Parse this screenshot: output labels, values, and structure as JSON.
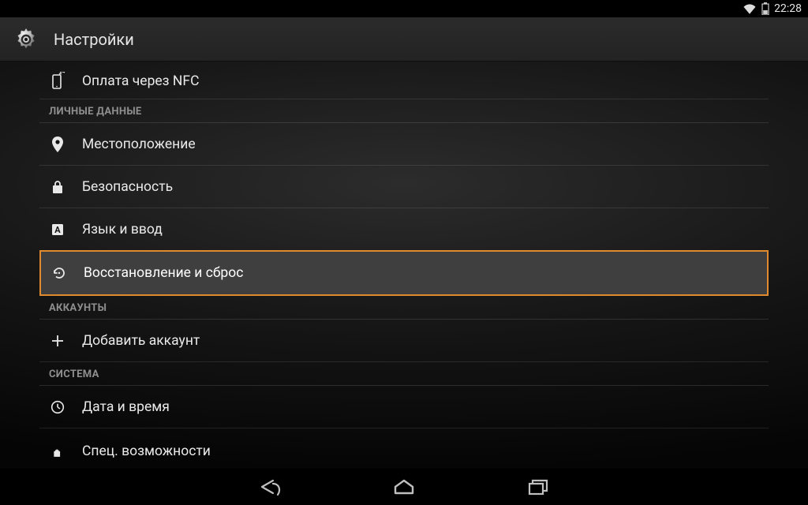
{
  "statusbar": {
    "time": "22:28"
  },
  "header": {
    "title": "Настройки"
  },
  "sections": {
    "nfc_pay": "Оплата через NFC",
    "personal_header": "ЛИЧНЫЕ ДАННЫЕ",
    "location": "Местоположение",
    "security": "Безопасность",
    "language": "Язык и ввод",
    "backup_reset": "Восстановление и сброс",
    "accounts_header": "АККАУНТЫ",
    "add_account": "Добавить аккаунт",
    "system_header": "СИСТЕМА",
    "date_time": "Дата и время",
    "accessibility": "Спец. возможности"
  }
}
